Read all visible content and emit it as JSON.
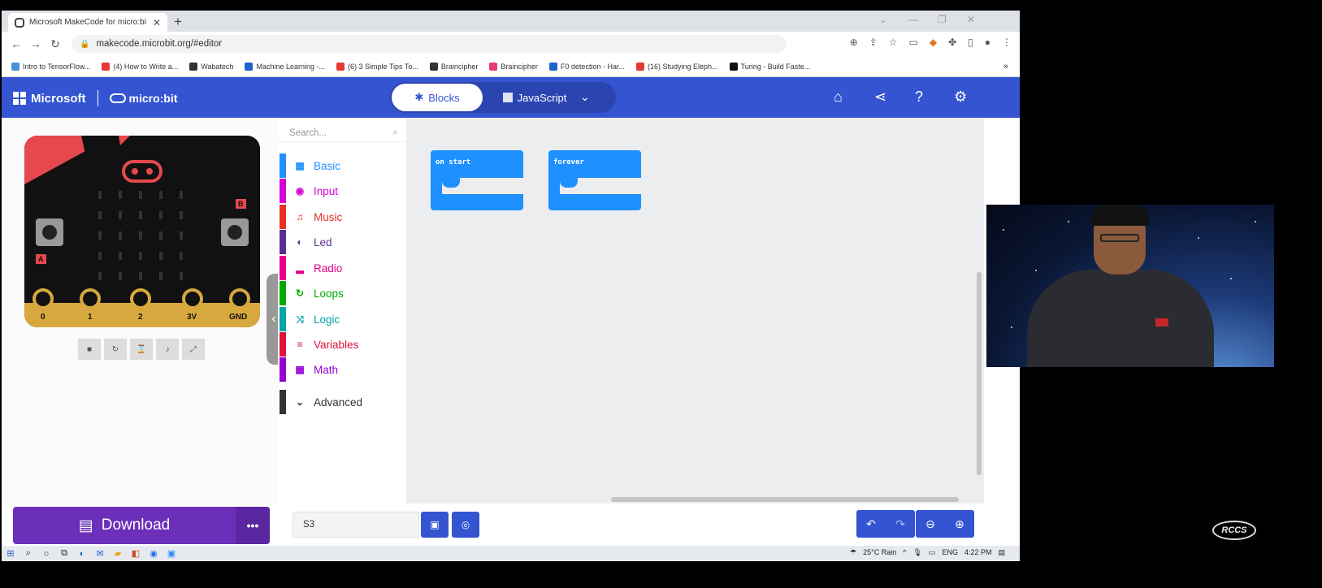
{
  "browser": {
    "tab_title": "Microsoft MakeCode for micro:bi",
    "url": "makecode.microbit.org/#editor",
    "bookmarks": [
      {
        "label": "Intro to TensorFlow...",
        "color": "#4a90d9"
      },
      {
        "label": "(4) How to Write a...",
        "color": "#e53935"
      },
      {
        "label": "Wabatech",
        "color": "#333333"
      },
      {
        "label": "Machine Learning -...",
        "color": "#1e63c8"
      },
      {
        "label": "(6) 3 Simple Tips To...",
        "color": "#e53935"
      },
      {
        "label": "Braincipher",
        "color": "#333333"
      },
      {
        "label": "Braincipher",
        "color": "#e5397a"
      },
      {
        "label": "F0 detection - Har...",
        "color": "#1e63c8"
      },
      {
        "label": "(16) Studying Eleph...",
        "color": "#e53935"
      },
      {
        "label": "Turing - Build Faste...",
        "color": "#111111"
      }
    ]
  },
  "header": {
    "brand": "Microsoft",
    "product": "micro:bit",
    "blocks_label": "Blocks",
    "javascript_label": "JavaScript"
  },
  "toolbox": {
    "search_placeholder": "Search...",
    "categories": [
      {
        "label": "Basic",
        "color": "#1e90ff",
        "icon": "▦"
      },
      {
        "label": "Input",
        "color": "#d400d4",
        "icon": "◉"
      },
      {
        "label": "Music",
        "color": "#e63022",
        "icon": "♫"
      },
      {
        "label": "Led",
        "color": "#5c2d91",
        "icon": "◐"
      },
      {
        "label": "Radio",
        "color": "#e3008c",
        "icon": "▂"
      },
      {
        "label": "Loops",
        "color": "#00aa00",
        "icon": "↻"
      },
      {
        "label": "Logic",
        "color": "#00a4a6",
        "icon": "⤨"
      },
      {
        "label": "Variables",
        "color": "#dc143c",
        "icon": "≡"
      },
      {
        "label": "Math",
        "color": "#9400d3",
        "icon": "▦"
      }
    ],
    "advanced_label": "Advanced"
  },
  "simulator": {
    "pins": [
      "0",
      "1",
      "2",
      "3V",
      "GND"
    ],
    "button_a": "A",
    "button_b": "B"
  },
  "workspace": {
    "blocks": [
      {
        "label": "on start"
      },
      {
        "label": "forever"
      }
    ]
  },
  "bottom": {
    "download_label": "Download",
    "more_label": "•••",
    "project_name": "S3"
  },
  "taskbar": {
    "weather": "25°C Rain",
    "language": "ENG",
    "time": "4:22 PM"
  },
  "watermark": "RCCS"
}
